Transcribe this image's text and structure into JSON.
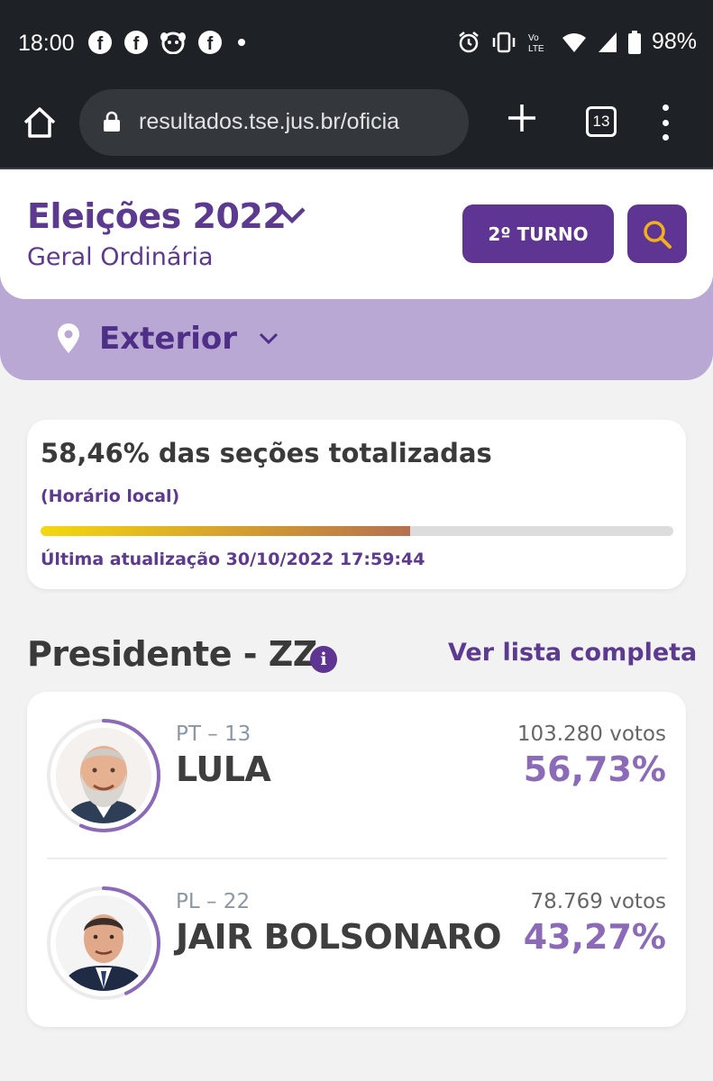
{
  "status_bar": {
    "time": "18:00",
    "battery": "98%",
    "fb_glyph": "f"
  },
  "browser": {
    "url": "resultados.tse.jus.br/oficia",
    "tab_count": "13"
  },
  "header": {
    "title": "Eleições 2022",
    "subtitle": "Geral Ordinária",
    "round_button": "2º TURNO"
  },
  "region": {
    "label": "Exterior"
  },
  "progress": {
    "sections_text": "58,46% das seções totalizadas",
    "sections_fraction": 0.5846,
    "local_time_label": "(Horário local)",
    "last_update": "Última atualização 30/10/2022 17:59:44"
  },
  "section": {
    "title": "Presidente - ZZ",
    "info_glyph": "i",
    "see_all": "Ver lista completa"
  },
  "candidates": [
    {
      "party": "PT – 13",
      "name": "LULA",
      "votes": "103.280 votos",
      "percent": "56,73%",
      "share": 0.5673
    },
    {
      "party": "PL – 22",
      "name": "JAIR BOLSONARO",
      "votes": "78.769 votos",
      "percent": "43,27%",
      "share": 0.4327
    }
  ],
  "colors": {
    "brand_purple": "#5e3592",
    "region_band": "#b9a8d3",
    "percent_purple": "#8b6ab8"
  }
}
